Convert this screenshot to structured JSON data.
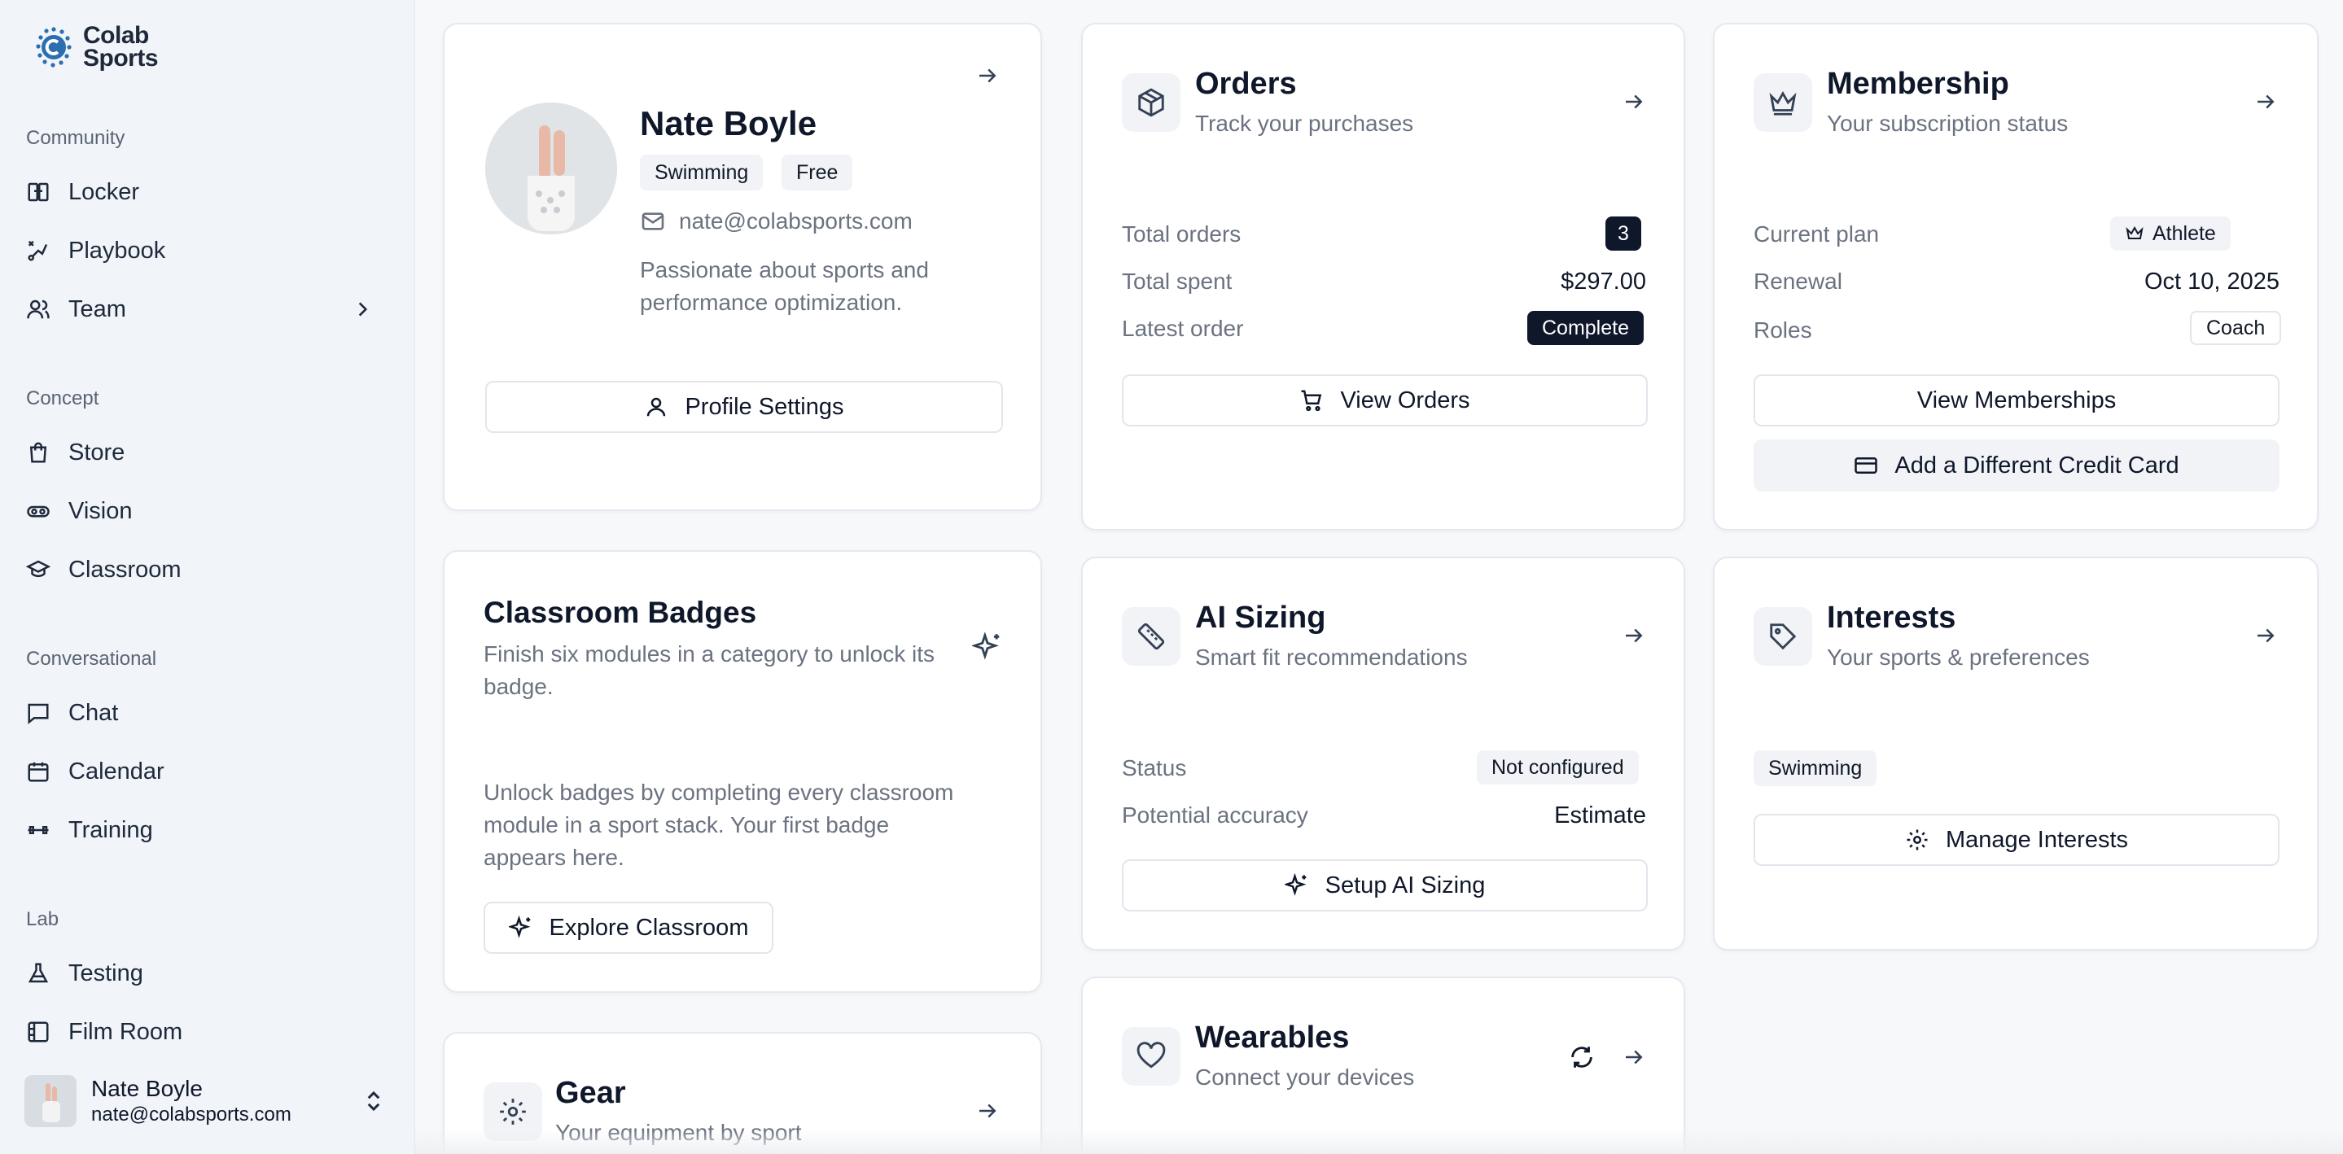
{
  "brand": {
    "line1": "Colab",
    "line2": "Sports"
  },
  "sidebar": {
    "sections": [
      {
        "title": "Community",
        "items": [
          {
            "label": "Locker",
            "icon": "locker-icon"
          },
          {
            "label": "Playbook",
            "icon": "playbook-icon"
          },
          {
            "label": "Team",
            "icon": "team-icon",
            "has_chevron": true
          }
        ]
      },
      {
        "title": "Concept",
        "items": [
          {
            "label": "Store",
            "icon": "store-icon"
          },
          {
            "label": "Vision",
            "icon": "vision-icon"
          },
          {
            "label": "Classroom",
            "icon": "graduation-cap-icon"
          }
        ]
      },
      {
        "title": "Conversational",
        "items": [
          {
            "label": "Chat",
            "icon": "chat-icon"
          },
          {
            "label": "Calendar",
            "icon": "calendar-icon"
          },
          {
            "label": "Training",
            "icon": "dumbbell-icon"
          }
        ]
      },
      {
        "title": "Lab",
        "items": [
          {
            "label": "Testing",
            "icon": "flask-icon"
          },
          {
            "label": "Film Room",
            "icon": "film-icon"
          }
        ]
      }
    ],
    "user": {
      "name": "Nate Boyle",
      "email": "nate@colabsports.com"
    }
  },
  "profile": {
    "name": "Nate Boyle",
    "tags": [
      "Swimming",
      "Free"
    ],
    "email": "nate@colabsports.com",
    "bio_line1": "Passionate about sports and",
    "bio_line2": "performance optimization.",
    "settings_label": "Profile Settings"
  },
  "orders": {
    "title": "Orders",
    "subtitle": "Track your purchases",
    "rows": [
      {
        "label": "Total orders",
        "value": "3"
      },
      {
        "label": "Total spent",
        "value": "$297.00"
      },
      {
        "label": "Latest order",
        "value": "Complete"
      }
    ],
    "button": "View Orders"
  },
  "membership": {
    "title": "Membership",
    "subtitle": "Your subscription status",
    "rows": [
      {
        "label": "Current plan",
        "value": "Athlete"
      },
      {
        "label": "Renewal",
        "value": "Oct 10, 2025"
      },
      {
        "label": "Roles",
        "value": "Coach"
      }
    ],
    "button_primary": "View Memberships",
    "button_secondary": "Add a Different Credit Card"
  },
  "badges": {
    "title": "Classroom Badges",
    "subtitle_line1": "Finish six modules in a category to unlock its",
    "subtitle_line2": "badge.",
    "body_line1": "Unlock badges by completing every classroom",
    "body_line2": "module in a sport stack. Your first badge",
    "body_line3": "appears here.",
    "button": "Explore Classroom"
  },
  "ai_sizing": {
    "title": "AI Sizing",
    "subtitle": "Smart fit recommendations",
    "rows": [
      {
        "label": "Status",
        "value": "Not configured"
      },
      {
        "label": "Potential accuracy",
        "value": "Estimate"
      }
    ],
    "button": "Setup AI Sizing"
  },
  "interests": {
    "title": "Interests",
    "subtitle": "Your sports & preferences",
    "tags": [
      "Swimming"
    ],
    "button": "Manage Interests"
  },
  "gear": {
    "title": "Gear",
    "subtitle": "Your equipment by sport"
  },
  "wearables": {
    "title": "Wearables",
    "subtitle": "Connect your devices"
  }
}
